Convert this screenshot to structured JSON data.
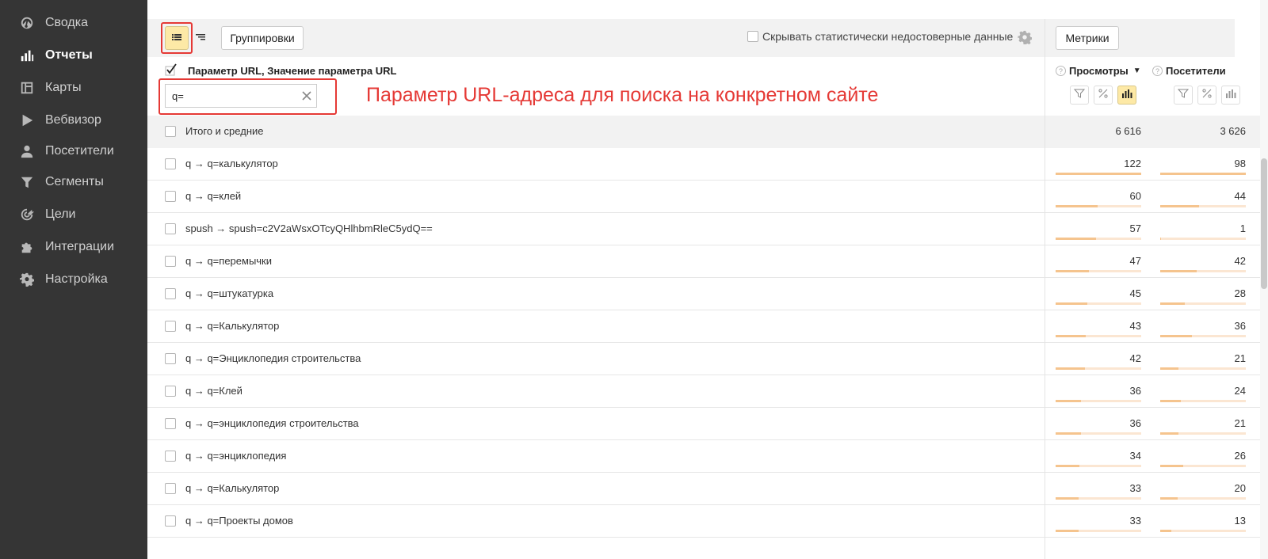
{
  "sidebar": {
    "items": [
      {
        "label": "Сводка",
        "icon": "dashboard-icon",
        "active": false
      },
      {
        "label": "Отчеты",
        "icon": "bar-chart-icon",
        "active": true
      },
      {
        "label": "Карты",
        "icon": "map-icon",
        "active": false
      },
      {
        "label": "Вебвизор",
        "icon": "play-icon",
        "active": false
      },
      {
        "label": "Посетители",
        "icon": "user-icon",
        "active": false
      },
      {
        "label": "Сегменты",
        "icon": "funnel-icon",
        "active": false
      },
      {
        "label": "Цели",
        "icon": "target-icon",
        "active": false
      },
      {
        "label": "Интеграции",
        "icon": "puzzle-icon",
        "active": false
      },
      {
        "label": "Настройка",
        "icon": "gear-icon",
        "active": false
      }
    ]
  },
  "toolbar": {
    "groupings_label": "Группировки",
    "hide_unreliable_label": "Скрывать статистически недостоверные данные",
    "metrics_label": "Метрики"
  },
  "dimension": {
    "title": "Параметр URL, Значение параметра URL",
    "filter_value": "q="
  },
  "annotation": "Параметр URL-адреса для поиска на конкретном сайте",
  "metrics": [
    {
      "title": "Просмотры",
      "sort": "▼",
      "help": "?"
    },
    {
      "title": "Посетители",
      "help": "?"
    }
  ],
  "colors": {
    "accent": "#fde9a6",
    "annotation": "#e53935",
    "bar": "#f5c48e",
    "bar_bg": "#fbe6d2"
  },
  "totals": {
    "label": "Итого и средние",
    "views": "6 616",
    "visitors": "3 626"
  },
  "rows": [
    {
      "label": "q → q=калькулятор",
      "views": "122",
      "visitors": "98",
      "views_share": 1.0,
      "visitors_share": 1.0
    },
    {
      "label": "q → q=клей",
      "views": "60",
      "visitors": "44",
      "views_share": 0.49,
      "visitors_share": 0.45
    },
    {
      "label": "spush → spush=c2V2aWsxOTcyQHlhbmRleC5ydQ==",
      "views": "57",
      "visitors": "1",
      "views_share": 0.47,
      "visitors_share": 0.01
    },
    {
      "label": "q → q=перемычки",
      "views": "47",
      "visitors": "42",
      "views_share": 0.39,
      "visitors_share": 0.43
    },
    {
      "label": "q → q=штукатурка",
      "views": "45",
      "visitors": "28",
      "views_share": 0.37,
      "visitors_share": 0.29
    },
    {
      "label": "q → q=Калькулятор",
      "views": "43",
      "visitors": "36",
      "views_share": 0.35,
      "visitors_share": 0.37
    },
    {
      "label": "q → q=Энциклопедия строительства",
      "views": "42",
      "visitors": "21",
      "views_share": 0.34,
      "visitors_share": 0.21
    },
    {
      "label": "q → q=Клей",
      "views": "36",
      "visitors": "24",
      "views_share": 0.3,
      "visitors_share": 0.24
    },
    {
      "label": "q → q=энциклопедия строительства",
      "views": "36",
      "visitors": "21",
      "views_share": 0.3,
      "visitors_share": 0.21
    },
    {
      "label": "q → q=энциклопедия",
      "views": "34",
      "visitors": "26",
      "views_share": 0.28,
      "visitors_share": 0.27
    },
    {
      "label": "q → q=Калькулятор",
      "views": "33",
      "visitors": "20",
      "views_share": 0.27,
      "visitors_share": 0.2
    },
    {
      "label": "q → q=Проекты домов",
      "views": "33",
      "visitors": "13",
      "views_share": 0.27,
      "visitors_share": 0.13
    }
  ]
}
